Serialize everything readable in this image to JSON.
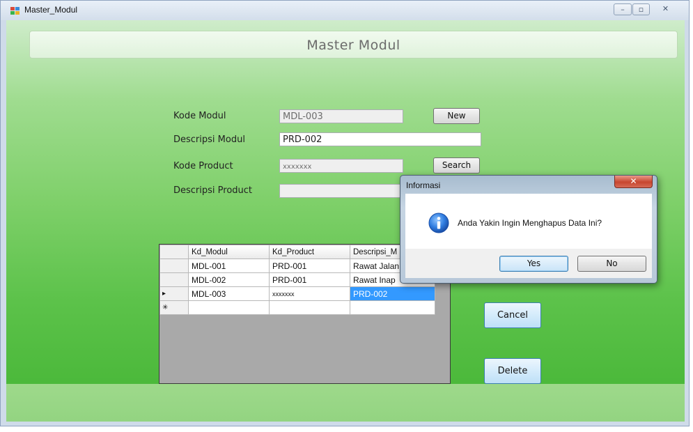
{
  "window": {
    "title": "Master_Modul",
    "minimize": "–",
    "maximize": "▫",
    "close": "✕"
  },
  "header": {
    "title": "Master Modul"
  },
  "form": {
    "kode_modul_label": "Kode Modul",
    "kode_modul_value": "MDL-003",
    "descripsi_modul_label": "Descripsi Modul",
    "descripsi_modul_value": "PRD-002",
    "kode_product_label": "Kode Product",
    "kode_product_value": "xxxxxxx",
    "descripsi_product_label": "Descripsi Product",
    "descripsi_product_value": "",
    "new_button": "New",
    "search_button": "Search"
  },
  "grid": {
    "columns": [
      "Kd_Modul",
      "Kd_Product",
      "Descripsi_M"
    ],
    "rows": [
      [
        "MDL-001",
        "PRD-001",
        "Rawat Jalan"
      ],
      [
        "MDL-002",
        "PRD-001",
        "Rawat Inap"
      ],
      [
        "MDL-003",
        "xxxxxxx",
        "PRD-002"
      ]
    ],
    "current_row_marker": "▸",
    "new_row_marker": "✳"
  },
  "actions": {
    "cancel_button": "Cancel",
    "delete_button": "Delete"
  },
  "dialog": {
    "title": "Informasi",
    "close": "✕",
    "message": "Anda Yakin Ingin Menghapus Data Ini?",
    "yes_button": "Yes",
    "no_button": "No"
  }
}
